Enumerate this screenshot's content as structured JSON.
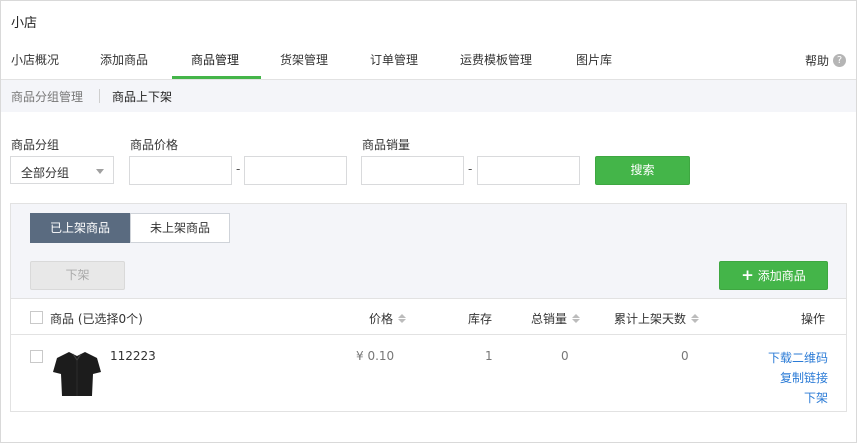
{
  "app_title": "小店",
  "nav": {
    "tabs": [
      "小店概况",
      "添加商品",
      "商品管理",
      "货架管理",
      "订单管理",
      "运费模板管理",
      "图片库"
    ],
    "active": "商品管理",
    "help": "帮助",
    "help_icon": "question-icon"
  },
  "subnav": {
    "items": [
      "商品分组管理",
      "商品上下架"
    ],
    "active": "商品上下架"
  },
  "filters": {
    "group_label": "商品分组",
    "group_value": "全部分组",
    "price_label": "商品价格",
    "price_min": "",
    "price_max": "",
    "sales_label": "商品销量",
    "sales_min": "",
    "sales_max": "",
    "range_sep": "-",
    "search_button": "搜索"
  },
  "segments": {
    "on_shelf": "已上架商品",
    "off_shelf": "未上架商品"
  },
  "actions": {
    "take_down": "下架",
    "add_product": "添加商品",
    "add_icon": "+"
  },
  "table": {
    "headers": {
      "product": "商品 (已选择0个)",
      "price": "价格",
      "stock": "库存",
      "total_sales": "总销量",
      "days_on_shelf": "累计上架天数",
      "operation": "操作"
    },
    "rows": [
      {
        "name": "112223",
        "price": "¥ 0.10",
        "stock": "1",
        "sales": "0",
        "days": "0",
        "ops": [
          "下载二维码",
          "复制链接",
          "下架"
        ]
      }
    ]
  },
  "colors": {
    "accent": "#44b549",
    "segment_active": "#5a6b80",
    "link": "#2b7bd6"
  }
}
